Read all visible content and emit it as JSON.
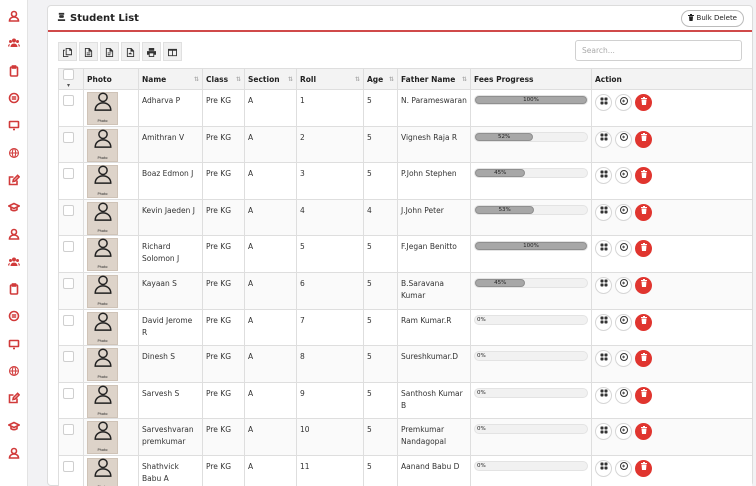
{
  "page": {
    "title": "Student List",
    "bulk_delete_label": "Bulk Delete",
    "search_placeholder": "Search..."
  },
  "toolbar": {
    "buttons": [
      "copy-icon",
      "csv-icon",
      "excel-icon",
      "pdf-icon",
      "print-icon",
      "columns-icon"
    ]
  },
  "sidebar": {
    "icons": [
      "user-icon",
      "users-icon",
      "clipboard-icon",
      "message-icon",
      "monitor-icon",
      "globe-icon",
      "edit-icon",
      "graduation-icon",
      "user-icon",
      "users-icon",
      "clipboard-icon",
      "message-icon",
      "monitor-icon",
      "globe-icon",
      "edit-icon",
      "graduation-icon",
      "user-icon"
    ]
  },
  "table": {
    "columns": [
      "",
      "Photo",
      "Name",
      "Class",
      "Section",
      "Roll",
      "Age",
      "Father Name",
      "Fees Progress",
      "Action"
    ],
    "photo_label": "Photo",
    "rows": [
      {
        "name": "Adharva P",
        "class": "Pre KG",
        "section": "A",
        "roll": "1",
        "age": "5",
        "father": "N. Parameswaran",
        "progress": 100,
        "progress_label": "100%"
      },
      {
        "name": "Amithran V",
        "class": "Pre KG",
        "section": "A",
        "roll": "2",
        "age": "5",
        "father": "Vignesh Raja R",
        "progress": 52,
        "progress_label": "52%"
      },
      {
        "name": "Boaz Edmon J",
        "class": "Pre KG",
        "section": "A",
        "roll": "3",
        "age": "5",
        "father": "P.John Stephen",
        "progress": 45,
        "progress_label": "45%"
      },
      {
        "name": "Kevin Jaeden J",
        "class": "Pre KG",
        "section": "A",
        "roll": "4",
        "age": "4",
        "father": "J.John Peter",
        "progress": 53,
        "progress_label": "53%"
      },
      {
        "name": "Richard Solomon J",
        "class": "Pre KG",
        "section": "A",
        "roll": "5",
        "age": "5",
        "father": "F.Jegan Benitto",
        "progress": 100,
        "progress_label": "100%"
      },
      {
        "name": "Kayaan S",
        "class": "Pre KG",
        "section": "A",
        "roll": "6",
        "age": "5",
        "father": "B.Saravana Kumar",
        "progress": 45,
        "progress_label": "45%"
      },
      {
        "name": "David Jerome R",
        "class": "Pre KG",
        "section": "A",
        "roll": "7",
        "age": "5",
        "father": "Ram Kumar.R",
        "progress": 0,
        "progress_label": "0%"
      },
      {
        "name": "Dinesh S",
        "class": "Pre KG",
        "section": "A",
        "roll": "8",
        "age": "5",
        "father": "Sureshkumar.D",
        "progress": 0,
        "progress_label": "0%"
      },
      {
        "name": "Sarvesh S",
        "class": "Pre KG",
        "section": "A",
        "roll": "9",
        "age": "5",
        "father": "Santhosh Kumar B",
        "progress": 0,
        "progress_label": "0%"
      },
      {
        "name": "Sarveshvaran premkumar",
        "class": "Pre KG",
        "section": "A",
        "roll": "10",
        "age": "5",
        "father": "Premkumar Nandagopal",
        "progress": 0,
        "progress_label": "0%"
      },
      {
        "name": "Shathvick Babu A",
        "class": "Pre KG",
        "section": "A",
        "roll": "11",
        "age": "5",
        "father": "Aanand Babu D",
        "progress": 0,
        "progress_label": "0%"
      }
    ]
  },
  "colors": {
    "accent": "#d13a3a",
    "delete": "#e0352f",
    "progress_fill": "#a7a7a7"
  }
}
